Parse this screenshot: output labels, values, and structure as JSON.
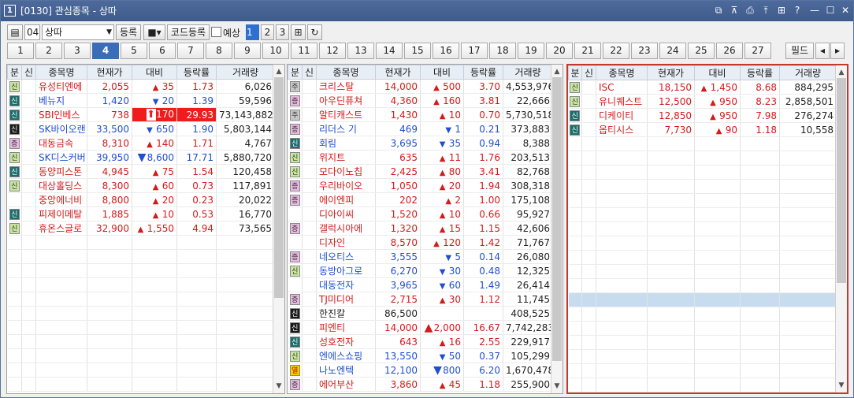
{
  "window": {
    "number": "1",
    "title": "[0130] 관심종목 - 상따",
    "icons": [
      "link-icon",
      "pin-icon",
      "print-icon",
      "export-icon",
      "grid-icon",
      "help-icon",
      "minimize-icon",
      "maximize-icon",
      "close-icon"
    ]
  },
  "toolbar": {
    "group_code": "04",
    "group_name": "상따",
    "register_label": "등록",
    "code_register_label": "코드등록",
    "prediction_label": "예상",
    "pages": [
      "1",
      "2",
      "3"
    ],
    "active_page": "1"
  },
  "tabs": {
    "items": [
      "1",
      "2",
      "3",
      "4",
      "5",
      "6",
      "7",
      "8",
      "9",
      "10",
      "11",
      "12",
      "13",
      "14",
      "15",
      "16",
      "17",
      "18",
      "19",
      "20",
      "21",
      "22",
      "23",
      "24",
      "25",
      "26",
      "27"
    ],
    "active": "4",
    "filter_label": "필드"
  },
  "columns": [
    "분",
    "신",
    "종목명",
    "현재가",
    "대비",
    "등락률",
    "거래량"
  ],
  "panels": [
    {
      "rows": [
        {
          "badge": "sin",
          "badge_text": "신",
          "name": "유성티엔에",
          "price": "2,055",
          "dir": "up",
          "chg": "35",
          "rate": "1.73",
          "vol": "6,026"
        },
        {
          "badge": "teal",
          "badge_text": "신",
          "name": "베뉴지",
          "price": "1,420",
          "dir": "dn",
          "chg": "20",
          "rate": "1.39",
          "vol": "59,596"
        },
        {
          "badge": "teal",
          "badge_text": "신",
          "name": "SBI인베스",
          "price": "738",
          "dir": "limit",
          "chg": "170",
          "rate": "29.93",
          "vol": "73,143,882"
        },
        {
          "badge": "dark",
          "badge_text": "신",
          "name": "SK바이오랜",
          "price": "33,500",
          "dir": "dn",
          "chg": "650",
          "rate": "1.90",
          "vol": "5,803,144"
        },
        {
          "badge": "jeung",
          "badge_text": "증",
          "name": "대동금속",
          "price": "8,310",
          "dir": "up",
          "chg": "140",
          "rate": "1.71",
          "vol": "4,767"
        },
        {
          "badge": "sin",
          "badge_text": "신",
          "name": "SK디스커버",
          "price": "39,950",
          "dir": "dnbig",
          "chg": "8,600",
          "rate": "17.71",
          "vol": "5,880,720"
        },
        {
          "badge": "teal",
          "badge_text": "신",
          "name": "동양피스톤",
          "price": "4,945",
          "dir": "up",
          "chg": "75",
          "rate": "1.54",
          "vol": "120,458"
        },
        {
          "badge": "sin",
          "badge_text": "신",
          "name": "대상홀딩스",
          "price": "8,300",
          "dir": "up",
          "chg": "60",
          "rate": "0.73",
          "vol": "117,891"
        },
        {
          "badge": "",
          "badge_text": "",
          "name": "중앙에너비",
          "price": "8,800",
          "dir": "up",
          "chg": "20",
          "rate": "0.23",
          "vol": "20,022"
        },
        {
          "badge": "teal",
          "badge_text": "신",
          "name": "피제이메탈",
          "price": "1,885",
          "dir": "up",
          "chg": "10",
          "rate": "0.53",
          "vol": "16,770"
        },
        {
          "badge": "sin",
          "badge_text": "신",
          "name": "휴온스글로",
          "price": "32,900",
          "dir": "up",
          "chg": "1,550",
          "rate": "4.94",
          "vol": "73,565"
        }
      ]
    },
    {
      "rows": [
        {
          "badge": "ju",
          "badge_text": "주",
          "name": "크리스탈",
          "price": "14,000",
          "dir": "up",
          "chg": "500",
          "rate": "3.70",
          "vol": "4,553,976"
        },
        {
          "badge": "jeung",
          "badge_text": "증",
          "name": "아우딘퓨쳐",
          "price": "4,360",
          "dir": "up",
          "chg": "160",
          "rate": "3.81",
          "vol": "22,666"
        },
        {
          "badge": "ju",
          "badge_text": "주",
          "name": "알티캐스트",
          "price": "1,430",
          "dir": "up",
          "chg": "10",
          "rate": "0.70",
          "vol": "5,730,518"
        },
        {
          "badge": "jeung",
          "badge_text": "증",
          "name": "리더스 기",
          "price": "469",
          "dir": "dn",
          "chg": "1",
          "rate": "0.21",
          "vol": "373,883"
        },
        {
          "badge": "teal",
          "badge_text": "신",
          "name": "회림",
          "price": "3,695",
          "dir": "dn",
          "chg": "35",
          "rate": "0.94",
          "vol": "8,388"
        },
        {
          "badge": "sin",
          "badge_text": "신",
          "name": "위지트",
          "price": "635",
          "dir": "up",
          "chg": "11",
          "rate": "1.76",
          "vol": "203,513"
        },
        {
          "badge": "sin",
          "badge_text": "신",
          "name": "모다이노칩",
          "price": "2,425",
          "dir": "up",
          "chg": "80",
          "rate": "3.41",
          "vol": "82,768"
        },
        {
          "badge": "jeung",
          "badge_text": "증",
          "name": "우리바이오",
          "price": "1,050",
          "dir": "up",
          "chg": "20",
          "rate": "1.94",
          "vol": "308,318"
        },
        {
          "badge": "jeung",
          "badge_text": "증",
          "name": "에이엔피",
          "price": "202",
          "dir": "up",
          "chg": "2",
          "rate": "1.00",
          "vol": "175,108"
        },
        {
          "badge": "",
          "badge_text": "",
          "name": "디아이씨",
          "price": "1,520",
          "dir": "up",
          "chg": "10",
          "rate": "0.66",
          "vol": "95,927"
        },
        {
          "badge": "jeung",
          "badge_text": "증",
          "name": "갤럭시아에",
          "price": "1,320",
          "dir": "up",
          "chg": "15",
          "rate": "1.15",
          "vol": "42,606"
        },
        {
          "badge": "",
          "badge_text": "",
          "name": "디자인",
          "price": "8,570",
          "dir": "up",
          "chg": "120",
          "rate": "1.42",
          "vol": "71,767"
        },
        {
          "badge": "jeung",
          "badge_text": "증",
          "name": "네오티스",
          "price": "3,555",
          "dir": "dn",
          "chg": "5",
          "rate": "0.14",
          "vol": "26,080"
        },
        {
          "badge": "sin",
          "badge_text": "신",
          "name": "동방아그로",
          "price": "6,270",
          "dir": "dn",
          "chg": "30",
          "rate": "0.48",
          "vol": "12,325"
        },
        {
          "badge": "",
          "badge_text": "",
          "name": "대동전자",
          "price": "3,965",
          "dir": "dn",
          "chg": "60",
          "rate": "1.49",
          "vol": "26,414"
        },
        {
          "badge": "jeung",
          "badge_text": "증",
          "name": "TJ미디어",
          "price": "2,715",
          "dir": "up",
          "chg": "30",
          "rate": "1.12",
          "vol": "11,745"
        },
        {
          "badge": "dark",
          "badge_text": "신",
          "name": "한진칼",
          "price": "86,500",
          "dir": "nt",
          "chg": "",
          "rate": "",
          "vol": "408,525"
        },
        {
          "badge": "dark",
          "badge_text": "신",
          "name": "피엔티",
          "price": "14,000",
          "dir": "upbig",
          "chg": "2,000",
          "rate": "16.67",
          "vol": "7,742,283"
        },
        {
          "badge": "teal",
          "badge_text": "신",
          "name": "성호전자",
          "price": "643",
          "dir": "up",
          "chg": "16",
          "rate": "2.55",
          "vol": "229,917"
        },
        {
          "badge": "sin",
          "badge_text": "신",
          "name": "엔에스쇼핑",
          "price": "13,550",
          "dir": "dn",
          "chg": "50",
          "rate": "0.37",
          "vol": "105,299"
        },
        {
          "badge": "yel",
          "badge_text": "열",
          "name": "나노엔텍",
          "price": "12,100",
          "dir": "dnbig",
          "chg": "800",
          "rate": "6.20",
          "vol": "1,670,478"
        },
        {
          "badge": "jeung",
          "badge_text": "증",
          "name": "에어부산",
          "price": "3,860",
          "dir": "up",
          "chg": "45",
          "rate": "1.18",
          "vol": "255,900"
        }
      ]
    },
    {
      "rows": [
        {
          "badge": "sin",
          "badge_text": "신",
          "name": "ISC",
          "price": "18,150",
          "dir": "up",
          "chg": "1,450",
          "rate": "8.68",
          "vol": "884,295"
        },
        {
          "badge": "sin",
          "badge_text": "신",
          "name": "유니퀘스트",
          "price": "12,500",
          "dir": "up",
          "chg": "950",
          "rate": "8.23",
          "vol": "2,858,501"
        },
        {
          "badge": "teal",
          "badge_text": "신",
          "name": "디케이티",
          "price": "12,850",
          "dir": "up",
          "chg": "950",
          "rate": "7.98",
          "vol": "276,274"
        },
        {
          "badge": "teal",
          "badge_text": "신",
          "name": "옵티시스",
          "price": "7,730",
          "dir": "up",
          "chg": "90",
          "rate": "1.18",
          "vol": "10,558"
        }
      ]
    }
  ]
}
